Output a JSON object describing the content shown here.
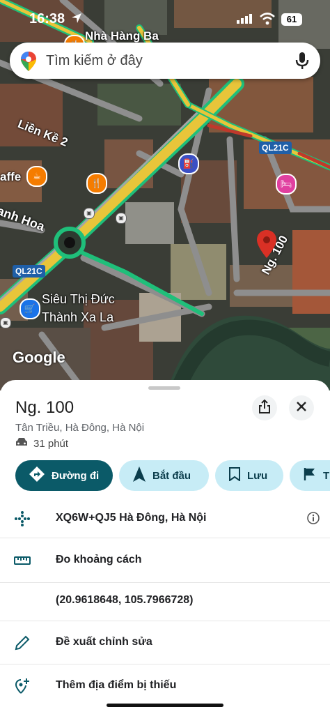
{
  "status_bar": {
    "time": "16:38",
    "battery": "61"
  },
  "search": {
    "placeholder": "Tìm kiếm ở đây"
  },
  "map": {
    "labels": {
      "nha_hang": "Nhà Hàng Ba",
      "lien_ke": "Liền Kề 2",
      "caffe": "affe",
      "thanh_hoa": "ạnh Hoa",
      "road_ng100": "Ng. 100",
      "sieu_thi_line1": "Siêu Thị Đức",
      "sieu_thi_line2": "Thành Xa La",
      "ql21c_a": "QL21C",
      "ql21c_b": "QL21C"
    },
    "watermark": "Google",
    "colors": {
      "road_yellow": "#e8c53a",
      "road_green": "#1fbf7a",
      "pin_red": "#d93025"
    }
  },
  "sheet": {
    "title": "Ng. 100",
    "address": "Tân Triều, Hà Đông, Hà Nội",
    "drive_time": "31 phút",
    "chips": [
      {
        "label": "Đường đi",
        "icon": "directions-icon"
      },
      {
        "label": "Bắt đầu",
        "icon": "navigation-arrow-icon"
      },
      {
        "label": "Lưu",
        "icon": "bookmark-icon"
      },
      {
        "label": "T",
        "icon": "flag-icon"
      }
    ],
    "rows": [
      {
        "label": "XQ6W+QJ5 Hà Đông, Hà Nội",
        "icon": "plus-code-icon"
      },
      {
        "label": "Đo khoảng cách",
        "icon": "ruler-icon"
      },
      {
        "label": "(20.9618648, 105.7966728)",
        "icon": ""
      },
      {
        "label": "Đề xuất chỉnh sửa",
        "icon": "pencil-icon"
      },
      {
        "label": "Thêm địa điểm bị thiếu",
        "icon": "add-place-icon"
      }
    ],
    "accent": "#0b5a68"
  }
}
